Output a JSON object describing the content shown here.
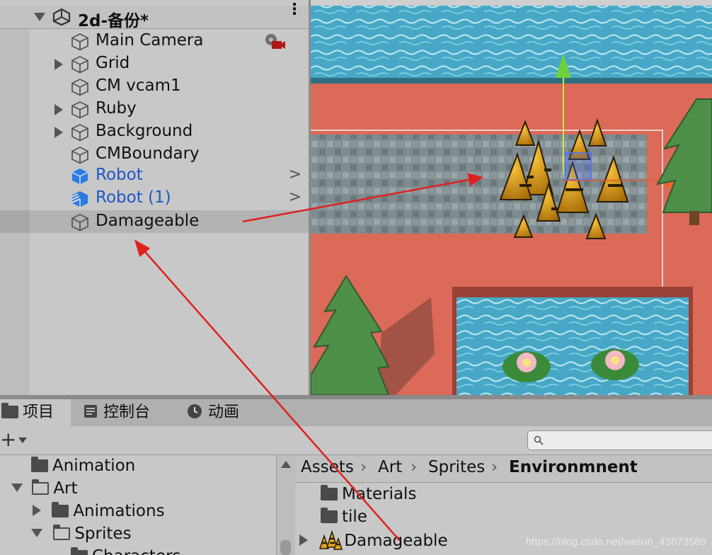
{
  "hierarchy": {
    "scene_title": "2d-备份*",
    "items": [
      {
        "label": "Main Camera",
        "icon": "gameobject-cube-icon"
      },
      {
        "label": "Grid",
        "icon": "gameobject-cube-icon"
      },
      {
        "label": "CM vcam1",
        "icon": "gameobject-cube-icon"
      },
      {
        "label": "Ruby",
        "icon": "gameobject-cube-icon"
      },
      {
        "label": "Background",
        "icon": "gameobject-cube-icon"
      },
      {
        "label": "CMBoundary",
        "icon": "gameobject-cube-icon"
      },
      {
        "label": "Robot",
        "icon": "prefab-cube-icon"
      },
      {
        "label": "Robot (1)",
        "icon": "prefab-variant-icon"
      },
      {
        "label": "Damageable",
        "icon": "gameobject-cube-icon"
      }
    ]
  },
  "project": {
    "tabs": [
      {
        "label": "项目",
        "icon": "folder-icon"
      },
      {
        "label": "控制台",
        "icon": "console-icon"
      },
      {
        "label": "动画",
        "icon": "clock-icon"
      }
    ],
    "search_placeholder": "",
    "tree": [
      {
        "label": "Animation"
      },
      {
        "label": "Art"
      },
      {
        "label": "Animations"
      },
      {
        "label": "Sprites"
      },
      {
        "label": "Characters"
      }
    ],
    "breadcrumb": [
      "Assets",
      "Art",
      "Sprites",
      "Environmnent"
    ],
    "assets": [
      {
        "label": "Materials",
        "icon": "folder-icon"
      },
      {
        "label": "tile",
        "icon": "folder-icon"
      },
      {
        "label": "Damageable",
        "icon": "sprite-thumbnail-icon"
      }
    ]
  },
  "watermark": "https://blog.csdn.net/weixin_43673589",
  "colors": {
    "annotation_arrow": "#e02020",
    "prefab_text": "#1f57c4",
    "water": "#4aa9c4",
    "ground": "#dc6a58"
  }
}
